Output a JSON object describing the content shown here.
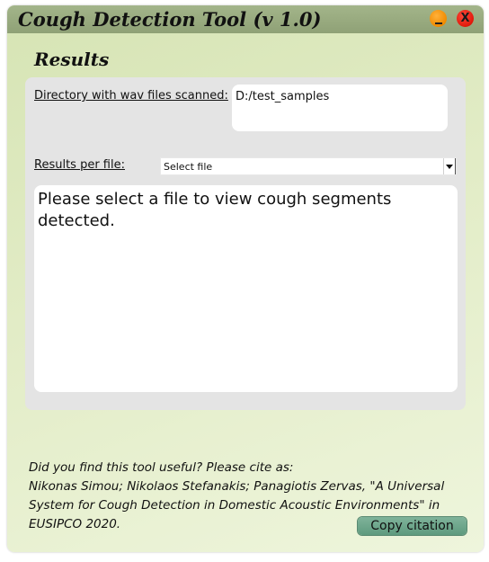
{
  "window": {
    "title": "Cough Detection Tool (v 1.0)",
    "minimize_icon": "minimize-icon",
    "close_label": "X",
    "close_icon": "close-icon"
  },
  "results": {
    "section_title": "Results",
    "directory_label": "Directory with wav files scanned:",
    "directory_value": "D:/test_samples",
    "per_file_label": "Results per file:",
    "per_file_selected": "Select file",
    "dropdown_icon": "chevron-down-icon",
    "output_line1": "Please select a file to view cough segments",
    "output_line2": "detected."
  },
  "citation": {
    "line1": "Did you find this tool useful? Please cite as:",
    "line2": "Nikonas Simou; Nikolaos Stefanakis; Panagiotis Zervas, \"A Universal",
    "line3": "System for Cough Detection in Domestic Acoustic Environments\" in",
    "line4": "EUSIPCO 2020.",
    "copy_button_label": "Copy citation"
  },
  "colors": {
    "titlebar": "#98aa7f",
    "background": "#e2ecc6",
    "panel": "#e4e4e4",
    "minimize": "#f08a00",
    "close": "#e0180a",
    "copy_button": "#6ea88c"
  }
}
